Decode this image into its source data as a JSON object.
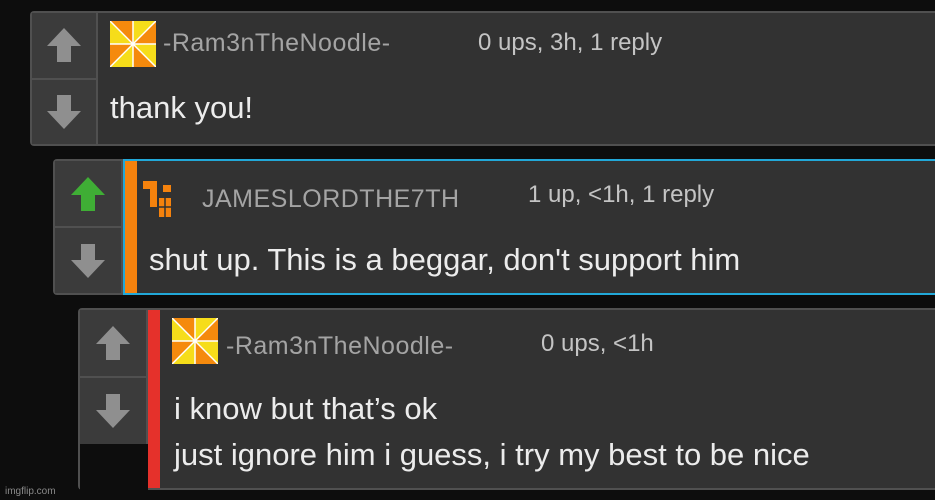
{
  "colors": {
    "upvote_active": "#3fae35",
    "vote_inactive": "#8f8f8f",
    "op_stripe": "#f5820d",
    "op_highlight_border": "#22a8d8",
    "reply_stripe": "#e5312b",
    "avatar_pinwheel_orange": "#f58a0d",
    "avatar_pinwheel_yellow": "#f6dd1a",
    "avatar_blocks_orange": "#f5820d"
  },
  "comments": [
    {
      "username": "-Ram3nTheNoodle-",
      "meta": "0 ups, 3h, 1 reply",
      "lines": [
        "thank you!"
      ],
      "upvote_icon": "up-arrow-icon",
      "downvote_icon": "down-arrow-icon",
      "avatar_icon": "pinwheel-avatar-icon"
    },
    {
      "username": "JAMESLORDTHE7TH",
      "meta": "1 up, <1h, 1 reply",
      "lines": [
        "shut up. This is a beggar, don't support him"
      ],
      "upvote_icon": "up-arrow-icon",
      "downvote_icon": "down-arrow-icon",
      "avatar_icon": "blocks-avatar-icon"
    },
    {
      "username": "-Ram3nTheNoodle-",
      "meta": "0 ups, <1h",
      "lines": [
        "i know but that’s ok",
        "just ignore him i guess, i try my best to be nice"
      ],
      "upvote_icon": "up-arrow-icon",
      "downvote_icon": "down-arrow-icon",
      "avatar_icon": "pinwheel-avatar-icon"
    }
  ],
  "watermark": "imgflip.com"
}
